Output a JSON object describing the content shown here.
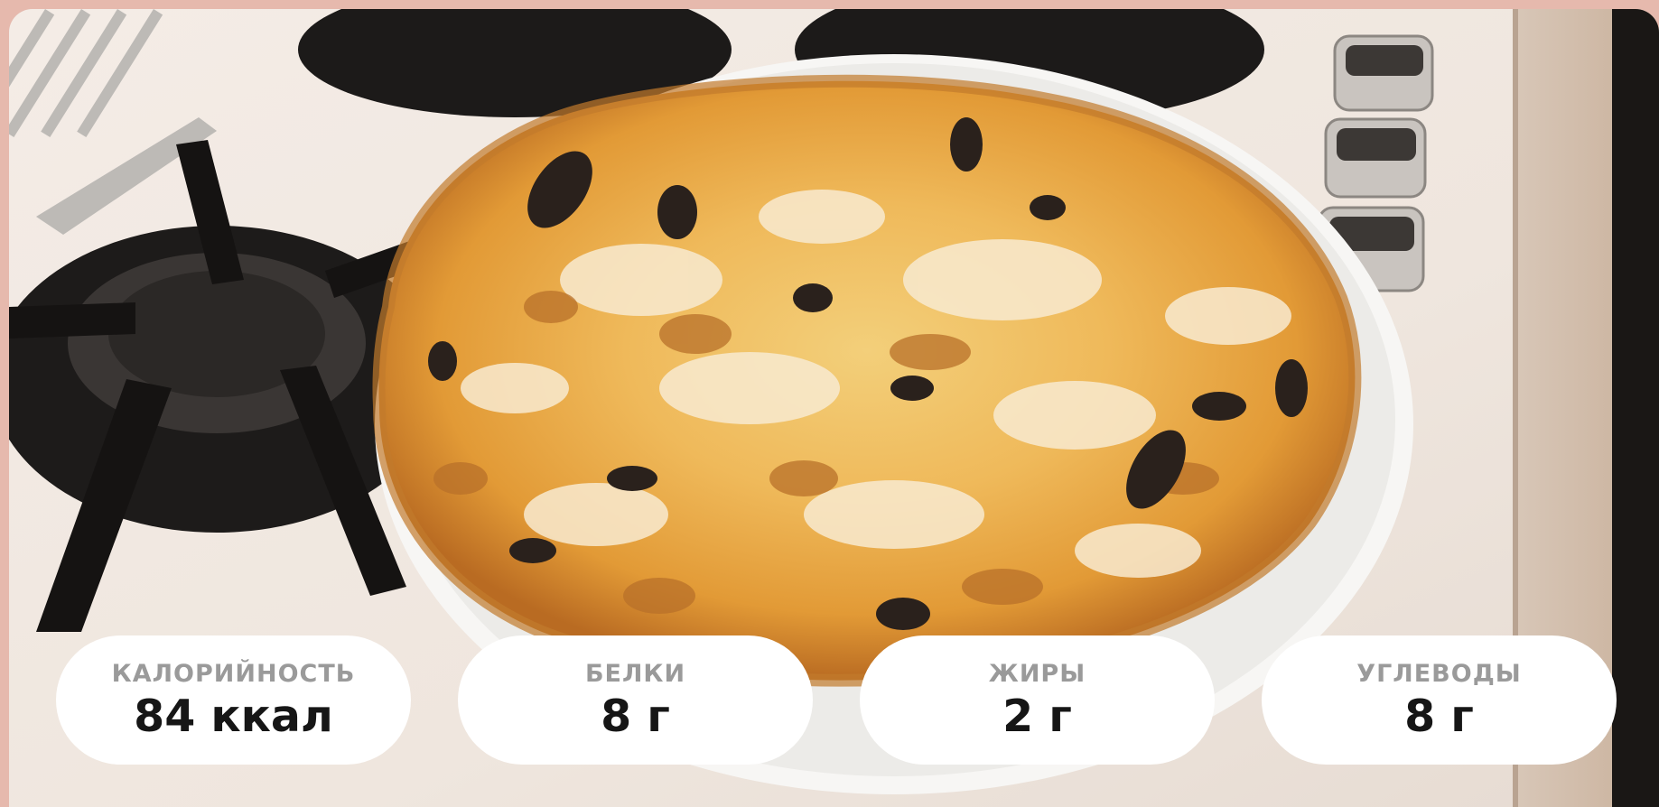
{
  "nutrition": [
    {
      "label": "КАЛОРИЙНОСТЬ",
      "value": "84 ккал"
    },
    {
      "label": "БЕЛКИ",
      "value": "8 г"
    },
    {
      "label": "ЖИРЫ",
      "value": "2 г"
    },
    {
      "label": "УГЛЕВОДЫ",
      "value": "8 г"
    }
  ]
}
